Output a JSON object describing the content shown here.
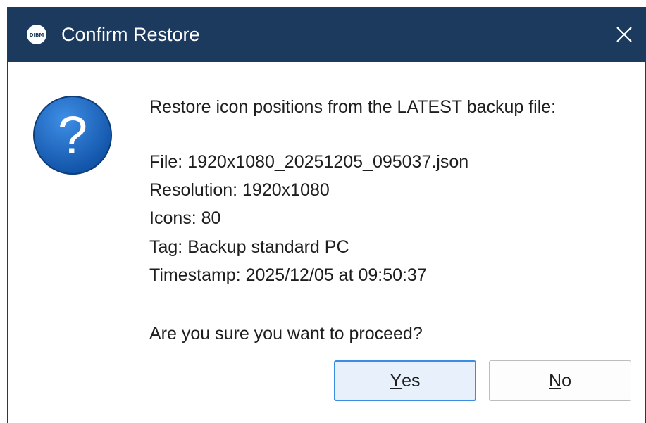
{
  "window": {
    "title": "Confirm Restore",
    "app_icon_text": "DIBM",
    "close_glyph": "✕"
  },
  "message": {
    "heading": "Restore icon positions from the LATEST backup file:",
    "details": [
      "File: 1920x1080_20251205_095037.json",
      "Resolution: 1920x1080",
      "Icons: 80",
      "Tag: Backup standard PC",
      "Timestamp: 2025/12/05 at 09:50:37"
    ],
    "question": "Are you sure you want to proceed?"
  },
  "buttons": {
    "yes": {
      "mnemonic": "Y",
      "rest": "es"
    },
    "no": {
      "mnemonic": "N",
      "rest": "o"
    }
  },
  "icons": {
    "app": "app-logo-icon",
    "close": "close-icon",
    "question": "question-icon"
  },
  "colors": {
    "titlebar": "#1c3a5e",
    "question_icon_fill": "#1565c0",
    "default_button_border": "#3a8de0"
  }
}
